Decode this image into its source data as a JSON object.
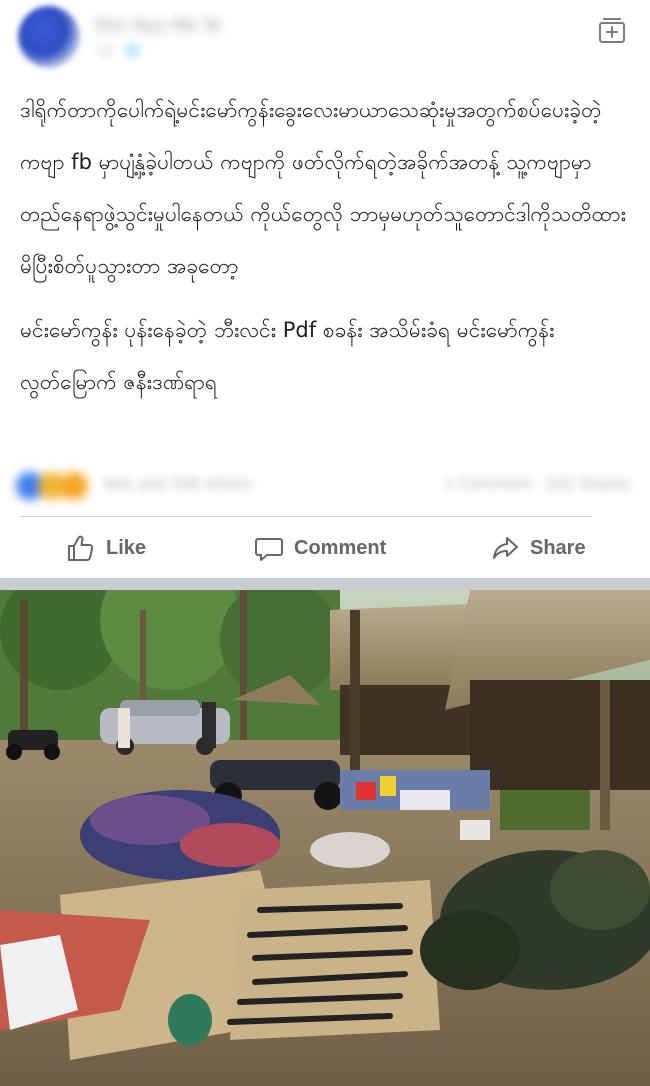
{
  "post": {
    "author_name": "Kim Nyo Me Te",
    "meta": "1d · 🌐",
    "paragraphs": [
      "ဒါရိုက်တာကိုပေါက်ရဲ့မင်းမော်ကွန်းခွေးလေးမာယာသေဆုံးမှုအတွက်စပ်ပေးခဲ့တဲ့ကဗျာ fb မှာပျံ့နှံ့ခဲ့ပါတယ် ကဗျာကို ဖတ်လိုက်ရတဲ့အခိုက်အတန့် သူ့ကဗျာမှာတည်နေရာဖွဲ့သွင်းမှုပါနေတယ် ကိုယ်တွေလို ဘာမှမဟုတ်သူတောင်ဒါကိုသတိထားမိပြီးစိတ်ပူသွားတာ အခုတော့",
      "မင်းမော်ကွန်း ပုန်းနေခဲ့တဲ့ ဘီးလင်း Pdf စခန်း အသိမ်းခံရ မင်းမော်ကွန်းလွတ်မြောက် ဇနီးဒဏ်ရာရ"
    ]
  },
  "reactions": {
    "count_text": "Nok and 598 others",
    "comments_shares_text": "1 Comment · 102 Shares"
  },
  "actions": {
    "like_label": "Like",
    "comment_label": "Comment",
    "share_label": "Share"
  },
  "colors": {
    "text": "#1c1e21",
    "action_gray": "#65676b",
    "separator": "#c9ccd1"
  },
  "icons": [
    "save-post-icon",
    "thumbs-up-icon",
    "comment-bubble-icon",
    "share-arrow-icon"
  ]
}
